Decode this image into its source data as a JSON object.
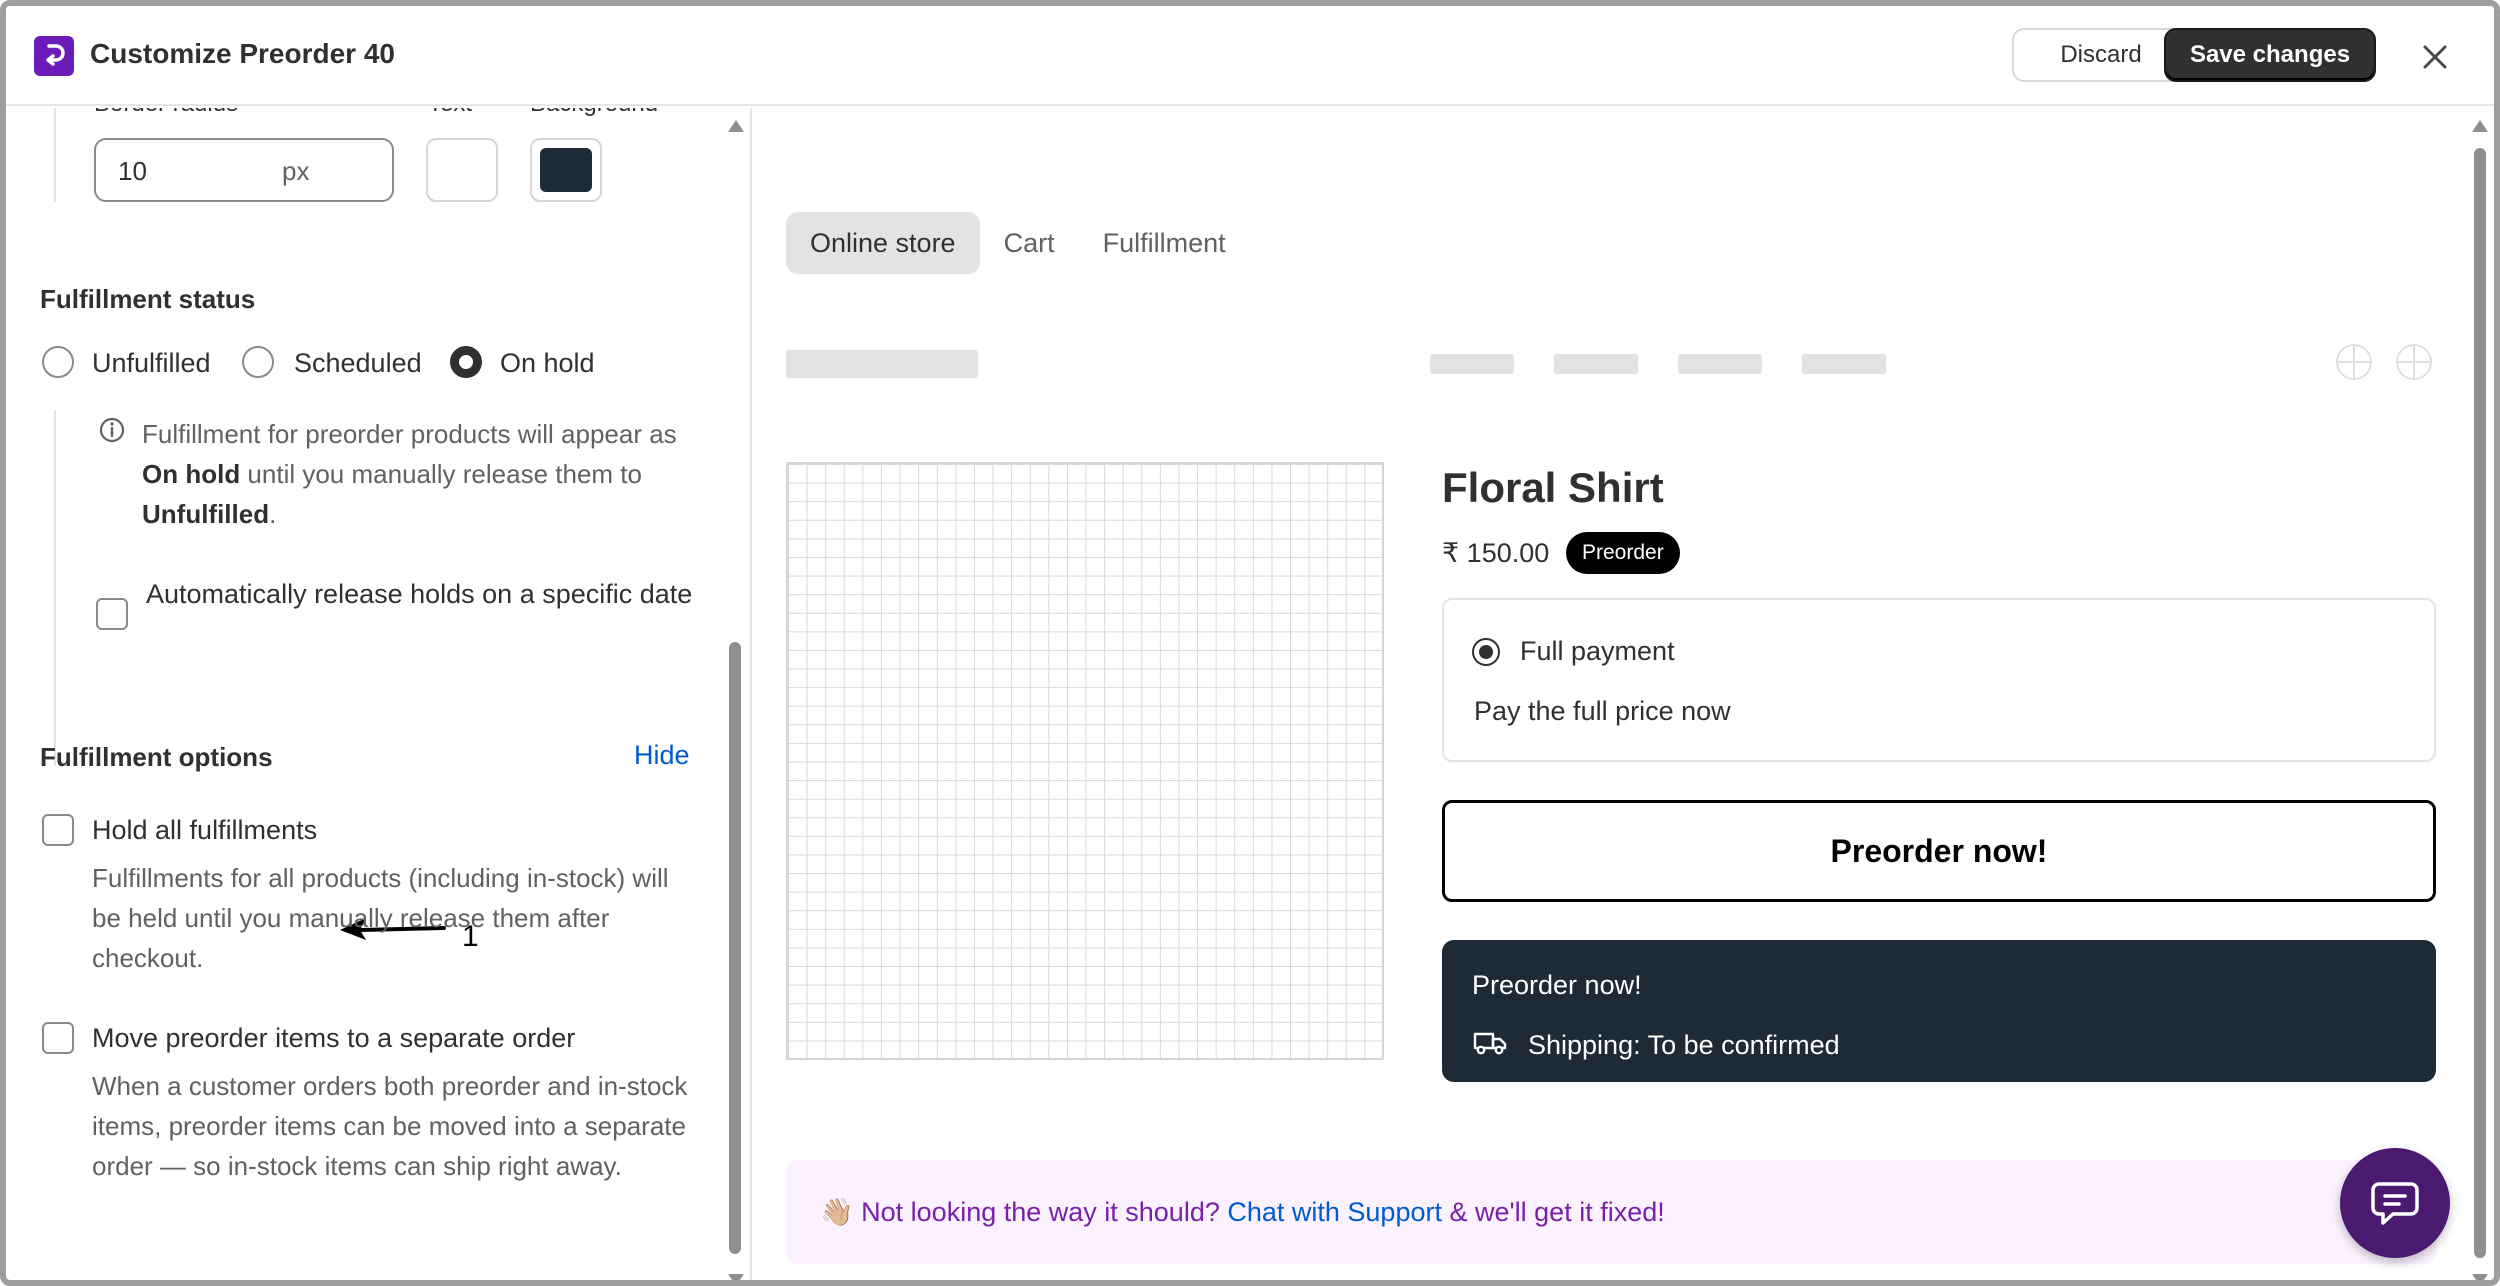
{
  "header": {
    "title": "Customize Preorder 40",
    "discard_label": "Discard",
    "save_label": "Save changes"
  },
  "style_section": {
    "border_radius_label": "Border radius",
    "text_label": "Text",
    "background_label": "Background",
    "border_radius_value": "10",
    "border_radius_unit": "px",
    "text_color": "#ffffff",
    "background_color": "#1f2a37"
  },
  "fulfillment_status": {
    "title": "Fulfillment status",
    "options": [
      "Unfulfilled",
      "Scheduled",
      "On hold"
    ],
    "selected": "On hold",
    "info_prefix": "Fulfillment for preorder products will appear as ",
    "info_bold_1": "On hold",
    "info_mid": " until you manually release them to ",
    "info_bold_2": "Unfulfilled",
    "info_suffix": ".",
    "auto_release_label": "Automatically release holds on a specific date"
  },
  "fulfillment_options": {
    "title": "Fulfillment options",
    "hide_label": "Hide",
    "hold_all_label": "Hold all fulfillments",
    "hold_all_help": "Fulfillments for all products (including in-stock) will be held until you manually release them after checkout.",
    "separate_label": "Move preorder items to a separate order",
    "separate_help": "When a customer orders both preorder and in-stock items, preorder items can be moved into a separate order — so in-stock items can ship right away.",
    "annotation_number": "1"
  },
  "preview": {
    "tabs": [
      "Online store",
      "Cart",
      "Fulfillment"
    ],
    "active_tab": "Online store",
    "product_title": "Floral Shirt",
    "price": "₹ 150.00",
    "badge": "Preorder",
    "payment_option": "Full payment",
    "payment_sub": "Pay the full price now",
    "preorder_button": "Preorder now!",
    "dark_title": "Preorder now!",
    "shipping": "Shipping: To be confirmed",
    "support_emoji": "👋🏼",
    "support_prefix": "Not looking the way it should? ",
    "support_link": "Chat with Support",
    "support_suffix": " & we'll get it fixed!"
  },
  "colors": {
    "accent": "#6b1bb8",
    "link": "#005bd3",
    "dark_box": "#1f2a37",
    "support_bg": "#fbf1ff",
    "support_text": "#7a1fa8"
  }
}
